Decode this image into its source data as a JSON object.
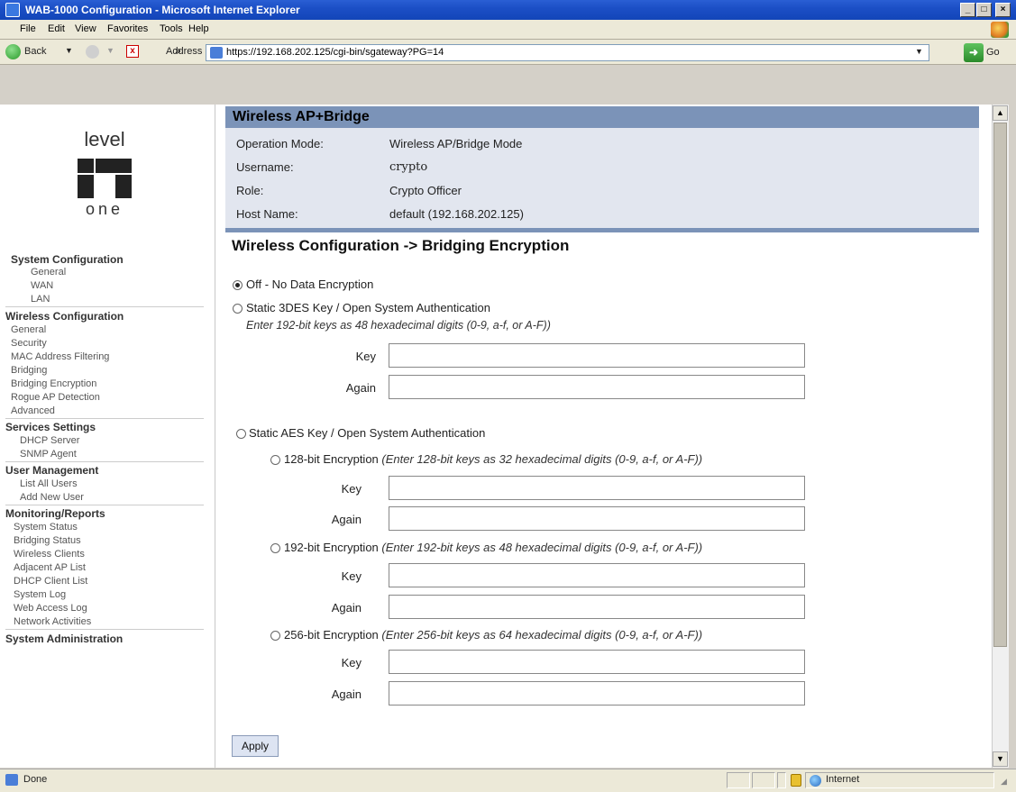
{
  "window": {
    "title": "WAB-1000 Configuration - Microsoft Internet Explorer"
  },
  "menu": [
    "File",
    "Edit",
    "View",
    "Favorites",
    "Tools",
    "Help"
  ],
  "toolbar": {
    "back_label": "Back",
    "chevron": "»",
    "address_label": "Address",
    "url": "https://192.168.202.125/cgi-bin/sgateway?PG=14",
    "go_label": "Go"
  },
  "logo": {
    "top": "level",
    "bottom": "one"
  },
  "nav": {
    "system_configuration": {
      "heading": "System Configuration",
      "items": [
        "General",
        "WAN",
        "LAN"
      ]
    },
    "wireless_configuration": {
      "heading": "Wireless Configuration",
      "items": [
        "General",
        "Security",
        "MAC Address Filtering",
        "Bridging",
        "Bridging Encryption",
        "Rogue AP Detection",
        "Advanced"
      ]
    },
    "services_settings": {
      "heading": "Services Settings",
      "items": [
        "DHCP Server",
        "SNMP Agent"
      ]
    },
    "user_management": {
      "heading": "User Management",
      "items": [
        "List All Users",
        "Add New User"
      ]
    },
    "monitoring_reports": {
      "heading": "Monitoring/Reports",
      "items": [
        "System Status",
        "Bridging Status",
        "Wireless Clients",
        "Adjacent AP List",
        "DHCP Client List",
        "System Log",
        "Web Access Log",
        "Network Activities"
      ]
    },
    "system_administration": {
      "heading": "System Administration"
    }
  },
  "header": {
    "title": "Wireless AP+Bridge",
    "rows": [
      {
        "label": "Operation Mode:",
        "value": "Wireless AP/Bridge Mode"
      },
      {
        "label": "Username:",
        "value": "crypto"
      },
      {
        "label": "Role:",
        "value": "Crypto Officer"
      },
      {
        "label": "Host Name:",
        "value": "default (192.168.202.125)"
      }
    ]
  },
  "section_title": "Wireless Configuration -> Bridging Encryption",
  "options": {
    "off": {
      "label": "Off - No Data Encryption",
      "selected": true
    },
    "static_3des": {
      "label": "Static 3DES Key / Open System Authentication",
      "hint": "Enter 192-bit keys as 48 hexadecimal digits (0-9, a-f, or A-F))",
      "key_label": "Key",
      "again_label": "Again",
      "key_value": "",
      "again_value": ""
    },
    "static_aes": {
      "label": "Static AES Key / Open System Authentication",
      "aes128": {
        "label": "128-bit Encryption",
        "hint": "(Enter 128-bit keys as 32 hexadecimal digits (0-9, a-f, or A-F))",
        "key_label": "Key",
        "again_label": "Again"
      },
      "aes192": {
        "label": "192-bit Encryption",
        "hint": "(Enter 192-bit keys as 48 hexadecimal digits (0-9, a-f, or A-F))",
        "key_label": "Key",
        "again_label": "Again"
      },
      "aes256": {
        "label": "256-bit Encryption",
        "hint": "(Enter 256-bit keys as 64 hexadecimal digits (0-9, a-f, or A-F))",
        "key_label": "Key",
        "again_label": "Again"
      }
    }
  },
  "apply_label": "Apply",
  "status": {
    "text": "Done",
    "zone": "Internet"
  },
  "colors": {
    "title_bar": "#1c4fc6",
    "header_band": "#7b93b8",
    "header_bg": "#e2e6ef"
  }
}
